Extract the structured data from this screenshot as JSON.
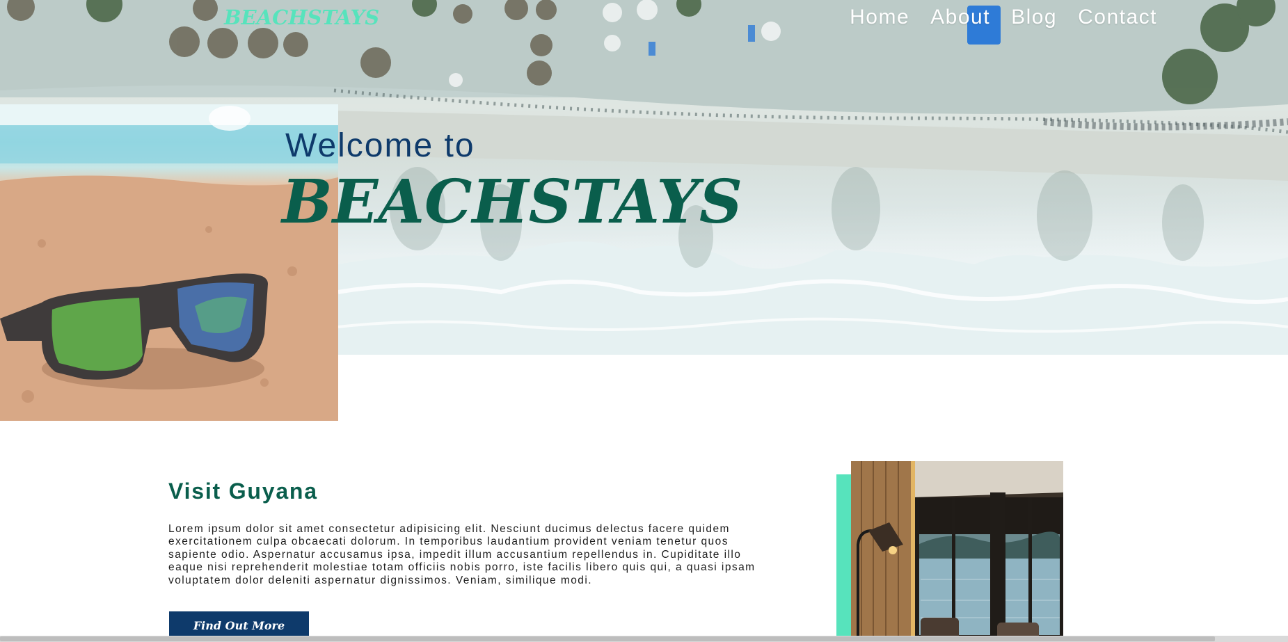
{
  "brand": {
    "logo_text": "BEACHSTAYS"
  },
  "nav": {
    "items": [
      "Home",
      "About",
      "Blog",
      "Contact"
    ]
  },
  "hero": {
    "welcome": "Welcome to",
    "title": "BEACHSTAYS"
  },
  "section": {
    "title": "Visit Guyana",
    "body": "Lorem ipsum dolor sit amet consectetur adipisicing elit. Nesciunt ducimus delectus facere quidem exercitationem culpa obcaecati dolorum. In temporibus laudantium provident veniam tenetur quos sapiente odio. Aspernatur accusamus ipsa, impedit illum accusantium repellendus in. Cupiditate illo eaque nisi reprehenderit molestiae totam officiis nobis porro, iste facilis libero quis qui, a quasi ipsam voluptatem dolor deleniti aspernatur dignissimos. Veniam, similique modi.",
    "cta": "Find Out More"
  },
  "colors": {
    "brand_mint": "#57e3bc",
    "brand_green": "#0a5e4c",
    "navy": "#0e3a6b"
  }
}
